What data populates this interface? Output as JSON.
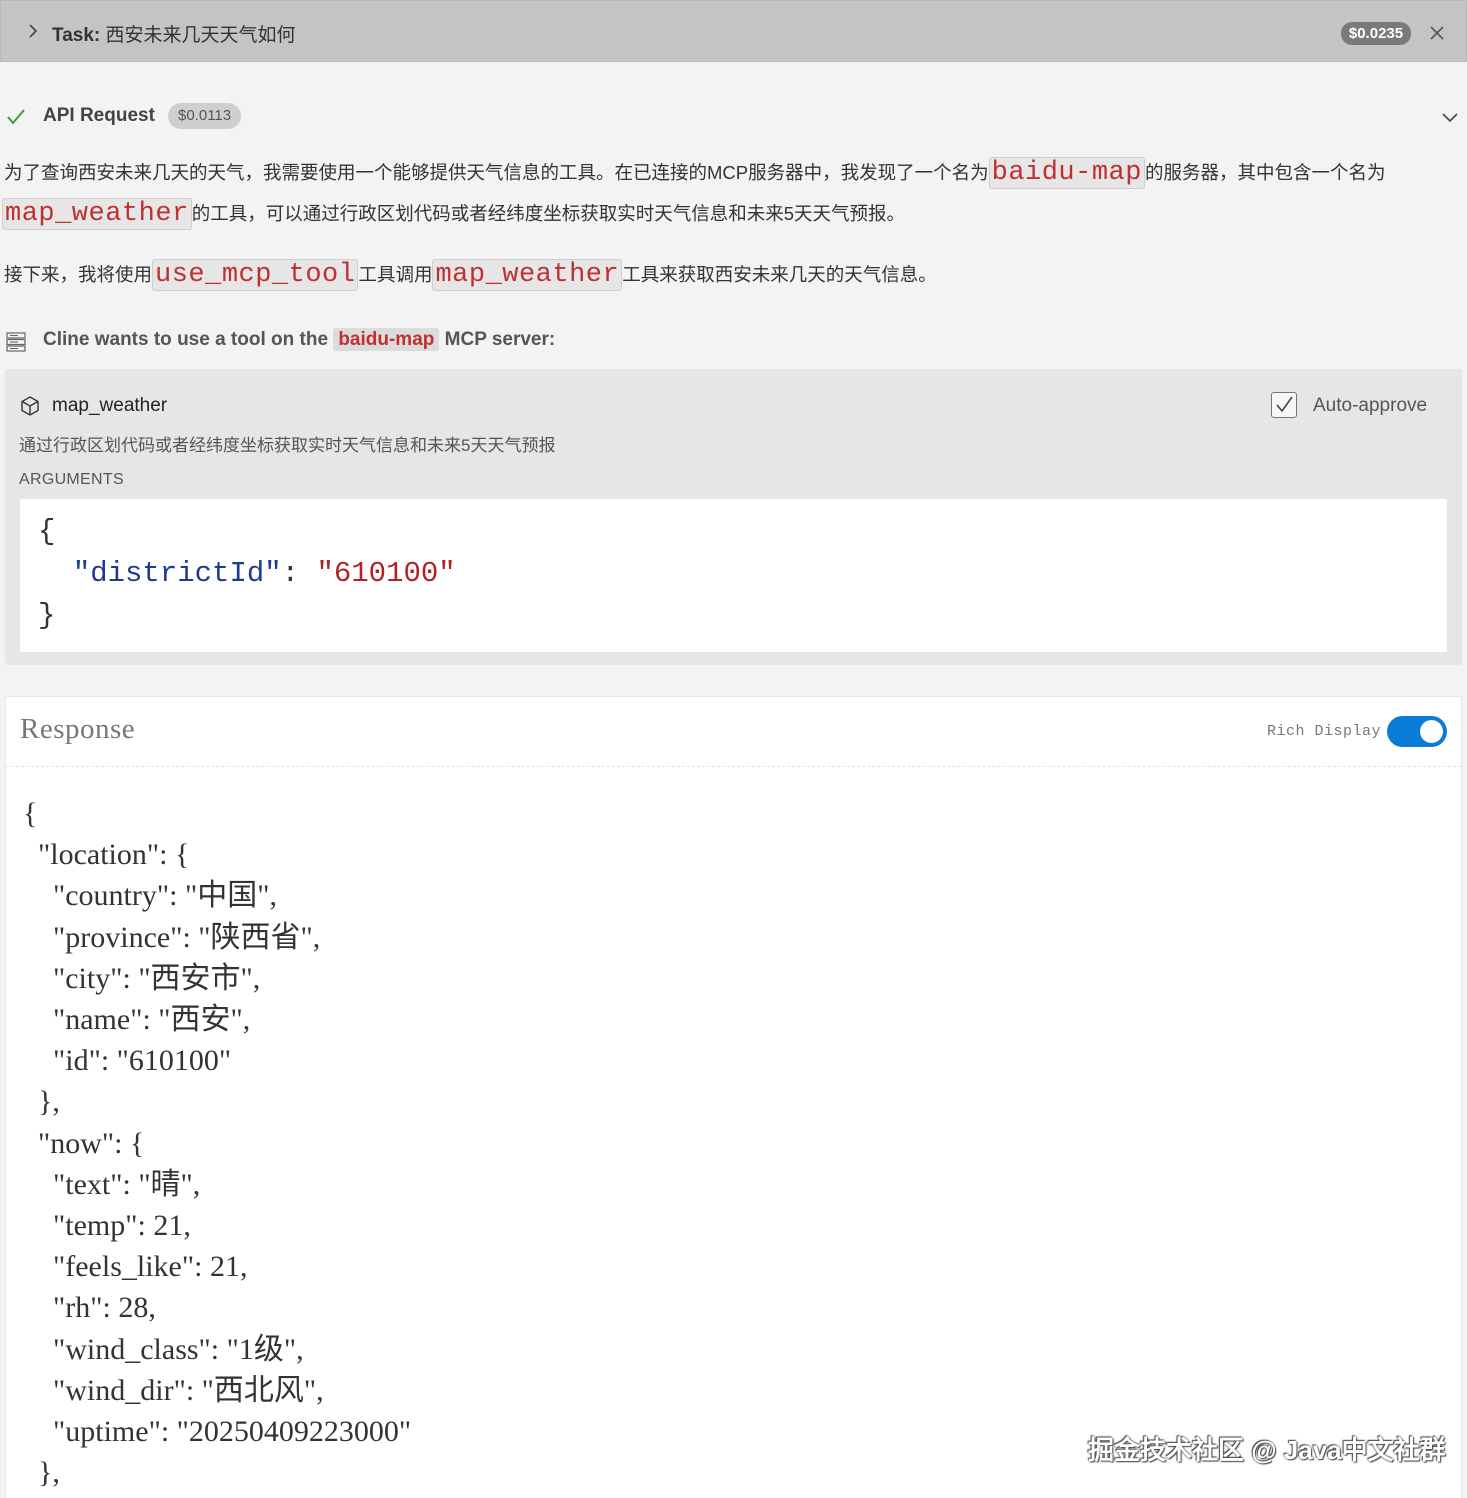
{
  "task": {
    "label": "Task:",
    "title": "西安未来几天天气如何",
    "cost": "$0.0235"
  },
  "api_request": {
    "label": "API Request",
    "cost": "$0.0113"
  },
  "message": {
    "p1_a": "为了查询西安未来几天的天气，我需要使用一个能够提供天气信息的工具。在已连接的MCP服务器中，我发现了一个名为",
    "p1_code1": "baidu-map",
    "p1_b": "的服务器，其中包含一个名为",
    "p1_code2": "map_weather",
    "p1_c": "的工具，可以通过行政区划代码或者经纬度坐标获取实时天气信息和未来5天天气预报。",
    "p2_a": "接下来，我将使用",
    "p2_code1": "use_mcp_tool",
    "p2_b": "工具调用",
    "p2_code2": "map_weather",
    "p2_c": "工具来获取西安未来几天的天气信息。"
  },
  "mcp": {
    "prefix": "Cline wants to use a tool on the",
    "server": "baidu-map",
    "suffix": "MCP server:"
  },
  "tool": {
    "name": "map_weather",
    "auto_approve_label": "Auto-approve",
    "auto_approve_checked": true,
    "description": "通过行政区划代码或者经纬度坐标获取实时天气信息和未来5天天气预报",
    "arguments_label": "ARGUMENTS",
    "arguments": {
      "key": "districtId",
      "value": "610100"
    }
  },
  "response": {
    "title": "Response",
    "rich_display_label": "Rich Display",
    "rich_display_on": true,
    "lines": [
      "{",
      "  \"location\": {",
      "    \"country\": \"中国\",",
      "    \"province\": \"陕西省\",",
      "    \"city\": \"西安市\",",
      "    \"name\": \"西安\",",
      "    \"id\": \"610100\"",
      "  },",
      "  \"now\": {",
      "    \"text\": \"晴\",",
      "    \"temp\": 21,",
      "    \"feels_like\": 21,",
      "    \"rh\": 28,",
      "    \"wind_class\": \"1级\",",
      "    \"wind_dir\": \"西北风\",",
      "    \"uptime\": \"20250409223000\"",
      "  },"
    ]
  },
  "watermark": "掘金技术社区 @ Java中文社群"
}
